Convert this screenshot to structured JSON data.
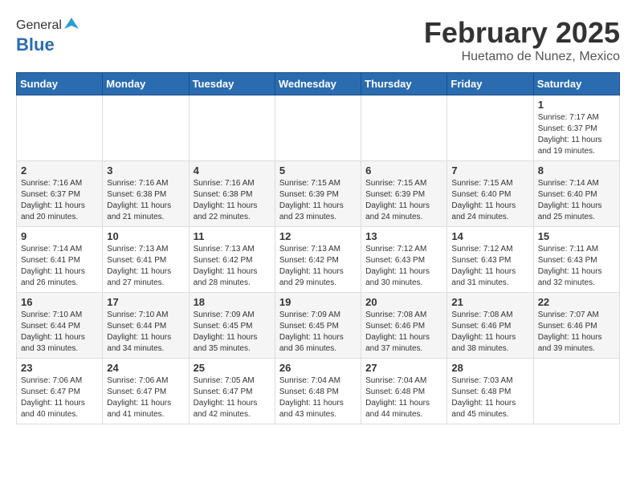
{
  "header": {
    "logo_general": "General",
    "logo_blue": "Blue",
    "month_title": "February 2025",
    "location": "Huetamo de Nunez, Mexico"
  },
  "weekdays": [
    "Sunday",
    "Monday",
    "Tuesday",
    "Wednesday",
    "Thursday",
    "Friday",
    "Saturday"
  ],
  "weeks": [
    [
      {
        "day": "",
        "info": ""
      },
      {
        "day": "",
        "info": ""
      },
      {
        "day": "",
        "info": ""
      },
      {
        "day": "",
        "info": ""
      },
      {
        "day": "",
        "info": ""
      },
      {
        "day": "",
        "info": ""
      },
      {
        "day": "1",
        "info": "Sunrise: 7:17 AM\nSunset: 6:37 PM\nDaylight: 11 hours and 19 minutes."
      }
    ],
    [
      {
        "day": "2",
        "info": "Sunrise: 7:16 AM\nSunset: 6:37 PM\nDaylight: 11 hours and 20 minutes."
      },
      {
        "day": "3",
        "info": "Sunrise: 7:16 AM\nSunset: 6:38 PM\nDaylight: 11 hours and 21 minutes."
      },
      {
        "day": "4",
        "info": "Sunrise: 7:16 AM\nSunset: 6:38 PM\nDaylight: 11 hours and 22 minutes."
      },
      {
        "day": "5",
        "info": "Sunrise: 7:15 AM\nSunset: 6:39 PM\nDaylight: 11 hours and 23 minutes."
      },
      {
        "day": "6",
        "info": "Sunrise: 7:15 AM\nSunset: 6:39 PM\nDaylight: 11 hours and 24 minutes."
      },
      {
        "day": "7",
        "info": "Sunrise: 7:15 AM\nSunset: 6:40 PM\nDaylight: 11 hours and 24 minutes."
      },
      {
        "day": "8",
        "info": "Sunrise: 7:14 AM\nSunset: 6:40 PM\nDaylight: 11 hours and 25 minutes."
      }
    ],
    [
      {
        "day": "9",
        "info": "Sunrise: 7:14 AM\nSunset: 6:41 PM\nDaylight: 11 hours and 26 minutes."
      },
      {
        "day": "10",
        "info": "Sunrise: 7:13 AM\nSunset: 6:41 PM\nDaylight: 11 hours and 27 minutes."
      },
      {
        "day": "11",
        "info": "Sunrise: 7:13 AM\nSunset: 6:42 PM\nDaylight: 11 hours and 28 minutes."
      },
      {
        "day": "12",
        "info": "Sunrise: 7:13 AM\nSunset: 6:42 PM\nDaylight: 11 hours and 29 minutes."
      },
      {
        "day": "13",
        "info": "Sunrise: 7:12 AM\nSunset: 6:43 PM\nDaylight: 11 hours and 30 minutes."
      },
      {
        "day": "14",
        "info": "Sunrise: 7:12 AM\nSunset: 6:43 PM\nDaylight: 11 hours and 31 minutes."
      },
      {
        "day": "15",
        "info": "Sunrise: 7:11 AM\nSunset: 6:43 PM\nDaylight: 11 hours and 32 minutes."
      }
    ],
    [
      {
        "day": "16",
        "info": "Sunrise: 7:10 AM\nSunset: 6:44 PM\nDaylight: 11 hours and 33 minutes."
      },
      {
        "day": "17",
        "info": "Sunrise: 7:10 AM\nSunset: 6:44 PM\nDaylight: 11 hours and 34 minutes."
      },
      {
        "day": "18",
        "info": "Sunrise: 7:09 AM\nSunset: 6:45 PM\nDaylight: 11 hours and 35 minutes."
      },
      {
        "day": "19",
        "info": "Sunrise: 7:09 AM\nSunset: 6:45 PM\nDaylight: 11 hours and 36 minutes."
      },
      {
        "day": "20",
        "info": "Sunrise: 7:08 AM\nSunset: 6:46 PM\nDaylight: 11 hours and 37 minutes."
      },
      {
        "day": "21",
        "info": "Sunrise: 7:08 AM\nSunset: 6:46 PM\nDaylight: 11 hours and 38 minutes."
      },
      {
        "day": "22",
        "info": "Sunrise: 7:07 AM\nSunset: 6:46 PM\nDaylight: 11 hours and 39 minutes."
      }
    ],
    [
      {
        "day": "23",
        "info": "Sunrise: 7:06 AM\nSunset: 6:47 PM\nDaylight: 11 hours and 40 minutes."
      },
      {
        "day": "24",
        "info": "Sunrise: 7:06 AM\nSunset: 6:47 PM\nDaylight: 11 hours and 41 minutes."
      },
      {
        "day": "25",
        "info": "Sunrise: 7:05 AM\nSunset: 6:47 PM\nDaylight: 11 hours and 42 minutes."
      },
      {
        "day": "26",
        "info": "Sunrise: 7:04 AM\nSunset: 6:48 PM\nDaylight: 11 hours and 43 minutes."
      },
      {
        "day": "27",
        "info": "Sunrise: 7:04 AM\nSunset: 6:48 PM\nDaylight: 11 hours and 44 minutes."
      },
      {
        "day": "28",
        "info": "Sunrise: 7:03 AM\nSunset: 6:48 PM\nDaylight: 11 hours and 45 minutes."
      },
      {
        "day": "",
        "info": ""
      }
    ]
  ]
}
